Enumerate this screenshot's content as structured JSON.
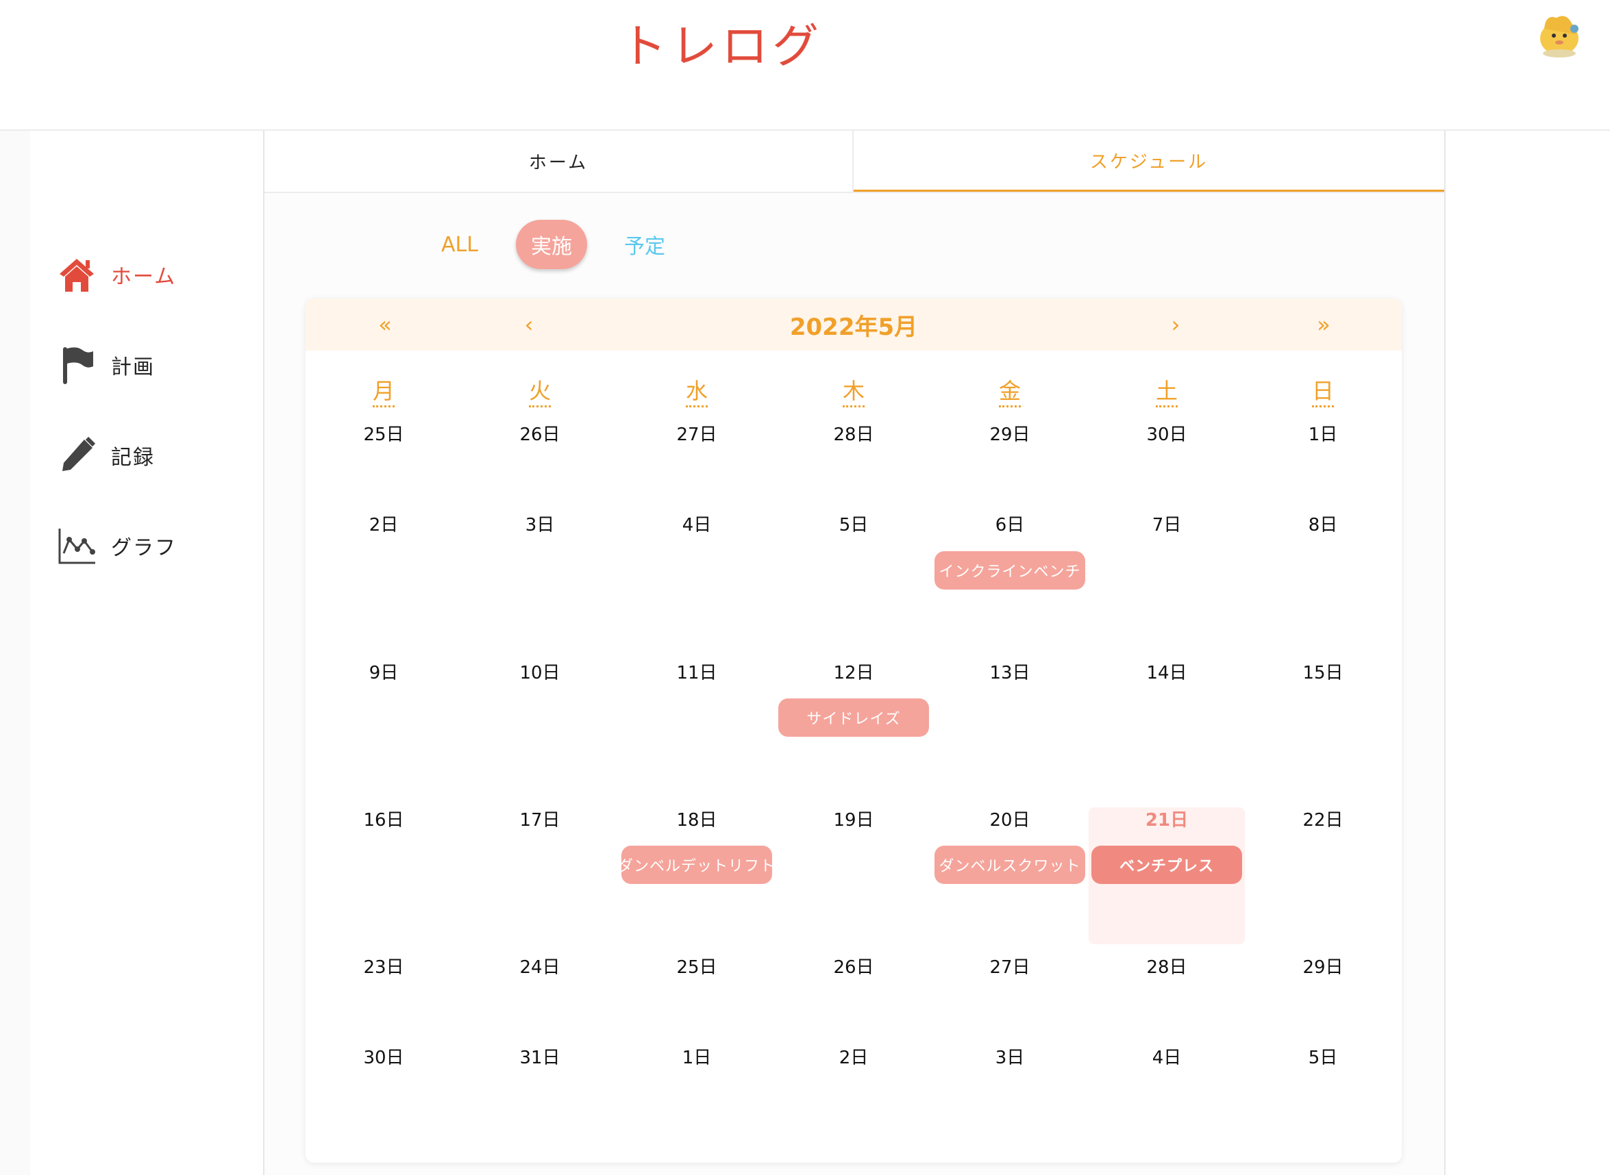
{
  "app": {
    "title": "トレログ"
  },
  "sidebar": {
    "items": [
      {
        "label": "ホーム",
        "icon": "home-icon"
      },
      {
        "label": "計画",
        "icon": "flag-icon"
      },
      {
        "label": "記録",
        "icon": "pencil-icon"
      },
      {
        "label": "グラフ",
        "icon": "chart-icon"
      }
    ]
  },
  "tabs": [
    {
      "label": "ホーム"
    },
    {
      "label": "スケジュール"
    }
  ],
  "filters": [
    {
      "label": "ALL"
    },
    {
      "label": "実施"
    },
    {
      "label": "予定"
    }
  ],
  "calendar": {
    "title": "2022年5月",
    "nav": {
      "prev_year": "«",
      "prev_month": "‹",
      "next_month": "›",
      "next_year": "»"
    },
    "weekdays": [
      "月",
      "火",
      "水",
      "木",
      "金",
      "土",
      "日"
    ],
    "weeks": [
      [
        "25日",
        "26日",
        "27日",
        "28日",
        "29日",
        "30日",
        "1日"
      ],
      [
        "2日",
        "3日",
        "4日",
        "5日",
        "6日",
        "7日",
        "8日"
      ],
      [
        "9日",
        "10日",
        "11日",
        "12日",
        "13日",
        "14日",
        "15日"
      ],
      [
        "16日",
        "17日",
        "18日",
        "19日",
        "20日",
        "21日",
        "22日"
      ],
      [
        "23日",
        "24日",
        "25日",
        "26日",
        "27日",
        "28日",
        "29日"
      ],
      [
        "30日",
        "31日",
        "1日",
        "2日",
        "3日",
        "4日",
        "5日"
      ]
    ],
    "events": [
      {
        "label": "インクラインベンチ"
      },
      {
        "label": "サイドレイズ"
      },
      {
        "label": "ダンベルデットリフト"
      },
      {
        "label": "ダンベルスクワット"
      },
      {
        "label": "ベンチプレス"
      }
    ]
  },
  "colors": {
    "accent_red": "#e24b3b",
    "accent_orange": "#f0a02a",
    "event_pink": "#f5a49b",
    "plan_blue": "#5bc8ee"
  }
}
